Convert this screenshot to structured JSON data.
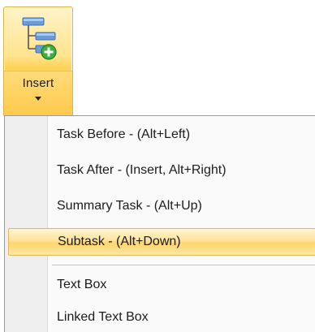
{
  "ribbon": {
    "insert_button": {
      "label": "Insert",
      "icon": "insert-task-hierarchy-icon",
      "accent_color": "#ffd35a"
    }
  },
  "menu": {
    "items": [
      {
        "label": "Task Before  -  (Alt+Left)",
        "selected": false
      },
      {
        "label": "Task After  -  (Insert, Alt+Right)",
        "selected": false
      },
      {
        "label": "Summary Task  -  (Alt+Up)",
        "selected": false
      },
      {
        "label": "Subtask  -  (Alt+Down)",
        "selected": true
      },
      {
        "label": "Text Box",
        "selected": false
      },
      {
        "label": "Linked Text Box",
        "selected": false
      }
    ],
    "highlight_color": "#ffe39a"
  }
}
